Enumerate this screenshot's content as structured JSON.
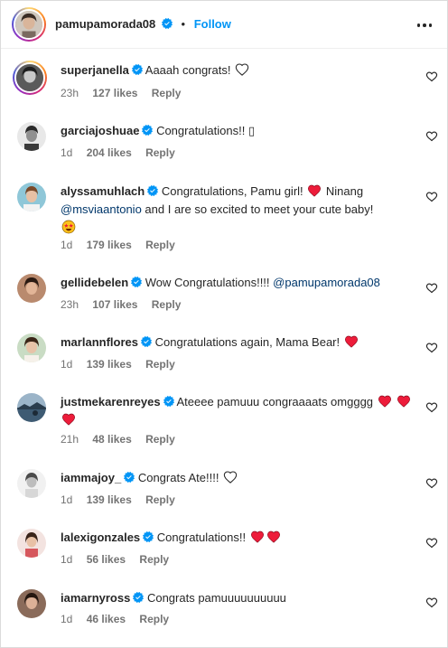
{
  "post_header": {
    "username": "pamupamorada08",
    "separator": "•",
    "follow_label": "Follow"
  },
  "comments": [
    {
      "username": "superjanella",
      "text": "Aaaah congrats!",
      "emoji": [
        "white-heart"
      ],
      "time": "23h",
      "likes": "127 likes",
      "reply": "Reply"
    },
    {
      "username": "garciajoshuae",
      "text": "Congratulations!! ▯",
      "emoji": [],
      "time": "1d",
      "likes": "204 likes",
      "reply": "Reply"
    },
    {
      "username": "alyssamuhlach",
      "text_a": "Congratulations, Pamu girl!",
      "text_b": "Ninang",
      "mention": "@msviaantonio",
      "text_c": "and I are so excited to meet your cute baby!",
      "time": "1d",
      "likes": "179 likes",
      "reply": "Reply"
    },
    {
      "username": "gellidebelen",
      "text": "Wow Congratulations!!!!",
      "mention": "@pamupamorada08",
      "time": "23h",
      "likes": "107 likes",
      "reply": "Reply"
    },
    {
      "username": "marlannflores",
      "text": "Congratulations again, Mama Bear!",
      "emoji": [
        "red-heart"
      ],
      "time": "1d",
      "likes": "139 likes",
      "reply": "Reply"
    },
    {
      "username": "justmekarenreyes",
      "text": "Ateeee pamuuu congraaaats omgggg",
      "emoji": [
        "red-heart",
        "red-heart",
        "red-heart"
      ],
      "time": "21h",
      "likes": "48 likes",
      "reply": "Reply"
    },
    {
      "username": "iammajoy_",
      "text": "Congrats Ate!!!!",
      "emoji": [
        "white-heart"
      ],
      "time": "1d",
      "likes": "139 likes",
      "reply": "Reply"
    },
    {
      "username": "lalexigonzales",
      "text": "Congratulations!!",
      "emoji": [
        "red-heart",
        "red-heart"
      ],
      "time": "1d",
      "likes": "56 likes",
      "reply": "Reply"
    },
    {
      "username": "iamarnyross",
      "text": "Congrats pamuuuuuuuuuu",
      "emoji": [],
      "time": "1d",
      "likes": "46 likes",
      "reply": "Reply"
    }
  ],
  "colors": {
    "link": "#0095f6",
    "mention": "#00376b",
    "heart": "#ed1c3a",
    "verified": "#0095f6",
    "muted": "#737373"
  }
}
